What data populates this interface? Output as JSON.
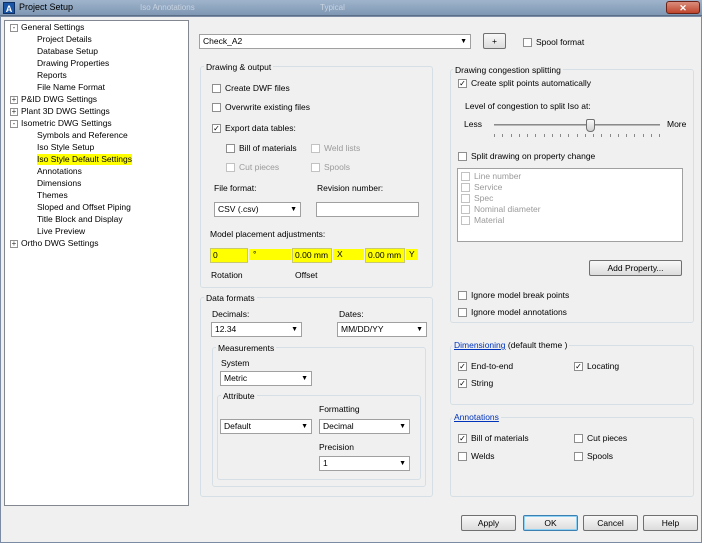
{
  "window": {
    "title": "Project Setup",
    "close_glyph": "✕",
    "ghost1": "Iso Annotations",
    "ghost2": "Typical"
  },
  "tree": {
    "expand_glyph": "-",
    "collapsed_glyph": "+",
    "items": [
      {
        "label": "General Settings"
      },
      {
        "label": "Project Details"
      },
      {
        "label": "Database Setup"
      },
      {
        "label": "Drawing Properties"
      },
      {
        "label": "Reports"
      },
      {
        "label": "File Name Format"
      },
      {
        "label": "P&ID DWG Settings"
      },
      {
        "label": "Plant 3D DWG Settings"
      },
      {
        "label": "Isometric DWG Settings"
      },
      {
        "label": "Symbols and Reference"
      },
      {
        "label": "Iso Style Setup"
      },
      {
        "label": "Iso Style Default Settings"
      },
      {
        "label": "Annotations"
      },
      {
        "label": "Dimensions"
      },
      {
        "label": "Themes"
      },
      {
        "label": "Sloped and Offset Piping"
      },
      {
        "label": "Title Block and Display"
      },
      {
        "label": "Live Preview"
      },
      {
        "label": "Ortho DWG Settings"
      }
    ]
  },
  "top": {
    "style_value": "Check_A2",
    "add_button": "+",
    "spool_format": "Spool format"
  },
  "drawing_output": {
    "title": "Drawing & output",
    "create_dwf": "Create DWF files",
    "overwrite": "Overwrite existing files",
    "export_tables": "Export data tables:",
    "bom": "Bill of materials",
    "weld_lists": "Weld lists",
    "cut_pieces": "Cut pieces",
    "spools": "Spools",
    "file_format_label": "File format:",
    "file_format_value": "CSV (.csv)",
    "revision_label": "Revision number:",
    "revision_value": "",
    "placement_label": "Model placement adjustments:",
    "rotation_value": "0",
    "degree": "°",
    "offset_x_value": "0.00 mm",
    "x_label": "X",
    "offset_y_value": "0.00 mm",
    "y_label": "Y",
    "rotation_label": "Rotation",
    "offset_label": "Offset"
  },
  "data_formats": {
    "title": "Data formats",
    "decimals_label": "Decimals:",
    "decimals_value": "12.34",
    "dates_label": "Dates:",
    "dates_value": "MM/DD/YY",
    "measurements_title": "Measurements",
    "system_label": "System",
    "system_value": "Metric",
    "attribute_title": "Attribute",
    "attribute_value": "Default",
    "formatting_label": "Formatting",
    "formatting_value": "Decimal",
    "precision_label": "Precision",
    "precision_value": "1"
  },
  "congestion": {
    "title": "Drawing congestion splitting",
    "create_split": "Create split points automatically",
    "level_label": "Level of congestion to split Iso at:",
    "less": "Less",
    "more": "More",
    "split_property": "Split drawing on property change",
    "properties": [
      "Line number",
      "Service",
      "Spec",
      "Nominal diameter",
      "Material"
    ],
    "add_property": "Add Property...",
    "ignore_breaks": "Ignore model break points",
    "ignore_annotations": "Ignore model annotations",
    "slider_level": 0.58
  },
  "dimensioning": {
    "link": "Dimensioning",
    "theme": "(default theme )",
    "end_to_end": "End-to-end",
    "locating": "Locating",
    "string": "String"
  },
  "annotations": {
    "link": "Annotations",
    "bom": "Bill of materials",
    "cut_pieces": "Cut pieces",
    "welds": "Welds",
    "spools": "Spools"
  },
  "buttons": {
    "apply": "Apply",
    "ok": "OK",
    "cancel": "Cancel",
    "help": "Help"
  },
  "colors": {
    "highlight": "#ffff00",
    "link": "#0033bb"
  }
}
